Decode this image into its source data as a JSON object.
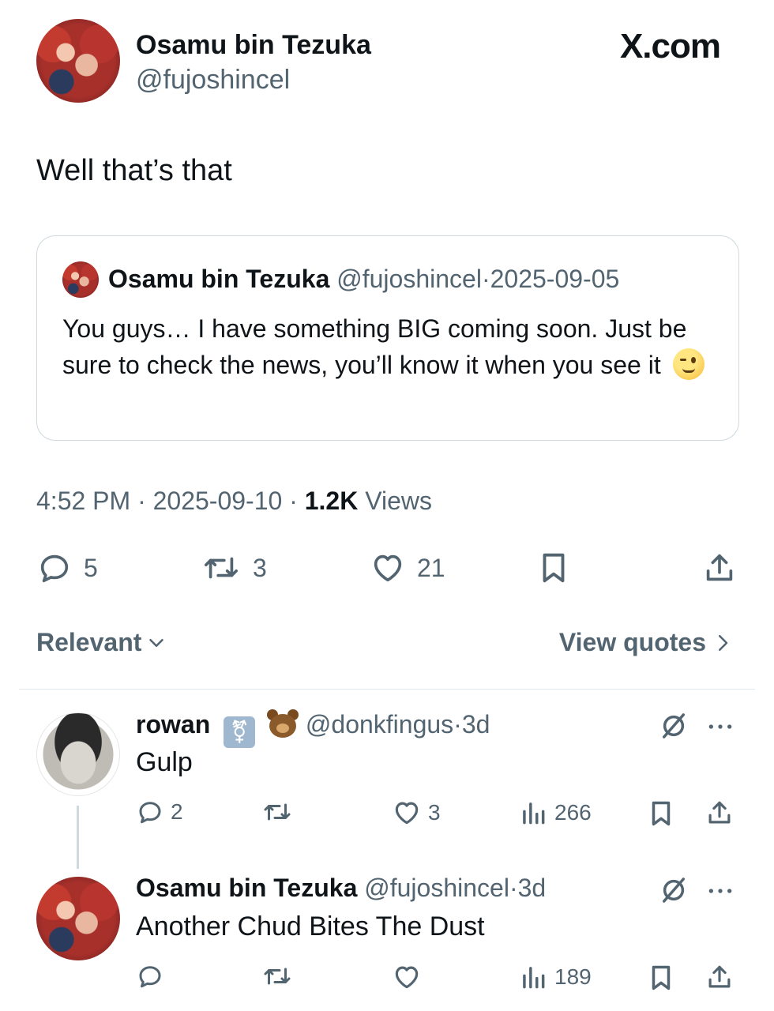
{
  "brand": {
    "logo_text": "X.com"
  },
  "tweet": {
    "author_name": "Osamu bin Tezuka",
    "author_handle": "@fujoshincel",
    "text": "Well that’s that",
    "time": "4:52 PM",
    "date": "2025-09-10",
    "views_count": "1.2K",
    "views_label": "Views",
    "separator": "·",
    "replies": "5",
    "retweets": "3",
    "likes": "21"
  },
  "quote": {
    "author_name": "Osamu bin Tezuka",
    "author_handle": "@fujoshincel",
    "date": "2025-09-05",
    "text": "You guys… I have something BIG coming soon. Just be sure to check the news, you’ll know it when you see it"
  },
  "sort": {
    "relevant_label": "Relevant",
    "view_quotes_label": "View quotes"
  },
  "replies": [
    {
      "author_name": "rowan",
      "badge_symbol": "⚧",
      "author_handle": "@donkfingus",
      "age": "3d",
      "text": "Gulp",
      "replies": "2",
      "likes": "3",
      "views": "266"
    },
    {
      "author_name": "Osamu bin Tezuka",
      "author_handle": "@fujoshincel",
      "age": "3d",
      "text": "Another Chud Bites The Dust",
      "views": "189"
    }
  ]
}
